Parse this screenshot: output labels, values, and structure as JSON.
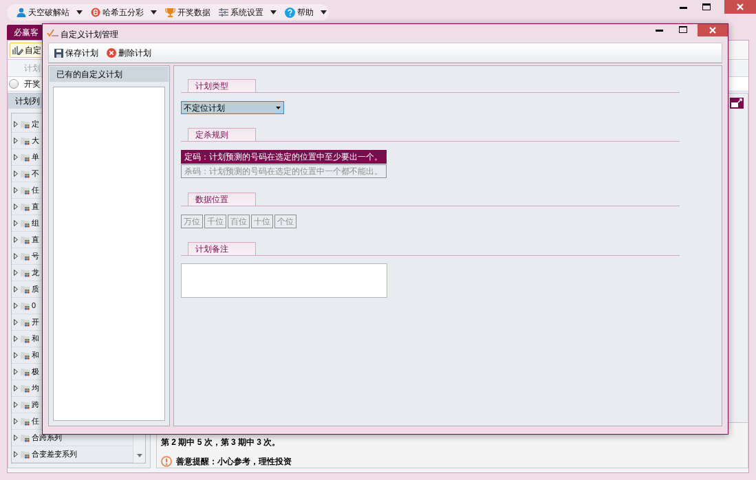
{
  "menu": [
    {
      "label": "天空破解站",
      "dropdown": true
    },
    {
      "label": "哈希五分彩",
      "dropdown": true
    },
    {
      "label": "开奖数据",
      "dropdown": false
    },
    {
      "label": "系统设置",
      "dropdown": true
    },
    {
      "label": "帮助",
      "dropdown": true
    }
  ],
  "tab": {
    "label": "必赢客",
    "selected": true
  },
  "toolbar_button": "自定",
  "section_label": "计划",
  "draw_option": {
    "label": "开奖",
    "selected": false
  },
  "plan_list": {
    "title": "计划列",
    "items": [
      {
        "label": "定",
        "expanded": false
      },
      {
        "label": "大",
        "expanded": false
      },
      {
        "label": "单",
        "expanded": false
      },
      {
        "label": "不",
        "expanded": false
      },
      {
        "label": "任",
        "expanded": false
      },
      {
        "label": "直",
        "expanded": false
      },
      {
        "label": "组",
        "expanded": false
      },
      {
        "label": "直",
        "expanded": false
      },
      {
        "label": "号",
        "expanded": false
      },
      {
        "label": "龙",
        "expanded": false
      },
      {
        "label": "质",
        "expanded": false
      },
      {
        "label": "0",
        "expanded": false
      },
      {
        "label": "开",
        "expanded": false
      },
      {
        "label": "和",
        "expanded": false
      },
      {
        "label": "和",
        "expanded": false
      },
      {
        "label": "极",
        "expanded": false
      },
      {
        "label": "均",
        "expanded": false
      },
      {
        "label": "跨",
        "expanded": false
      },
      {
        "label": "任",
        "expanded": false
      },
      {
        "label": "合跨系列",
        "expanded": false
      },
      {
        "label": "合变差变系列",
        "expanded": false
      }
    ]
  },
  "result_text": "第 2 期中 5 次，第 3 期中 3 次。",
  "reminder": "善意提醒：小心参考，理性投资",
  "dialog": {
    "title": "自定义计划管理",
    "toolbar": [
      {
        "label": "保存计划",
        "kind": "save"
      },
      {
        "label": "删除计划",
        "kind": "delete"
      }
    ],
    "plans_heading": "已有的自定义计划",
    "plan_type": {
      "label": "计划类型",
      "value": "不定位计划"
    },
    "rule": {
      "label": "定杀规则",
      "options": [
        {
          "label": "定码：计划预测的号码在选定的位置中至少要出一个。",
          "selected": true
        },
        {
          "label": "杀码：计划预测的号码在选定的位置中一个都不能出。",
          "selected": false
        }
      ]
    },
    "positions": {
      "label": "数据位置",
      "items": [
        {
          "label": "万位",
          "selected": false
        },
        {
          "label": "千位",
          "selected": false
        },
        {
          "label": "百位",
          "selected": false
        },
        {
          "label": "十位",
          "selected": false
        },
        {
          "label": "个位",
          "selected": false
        }
      ]
    },
    "note": {
      "label": "计划备注"
    }
  }
}
